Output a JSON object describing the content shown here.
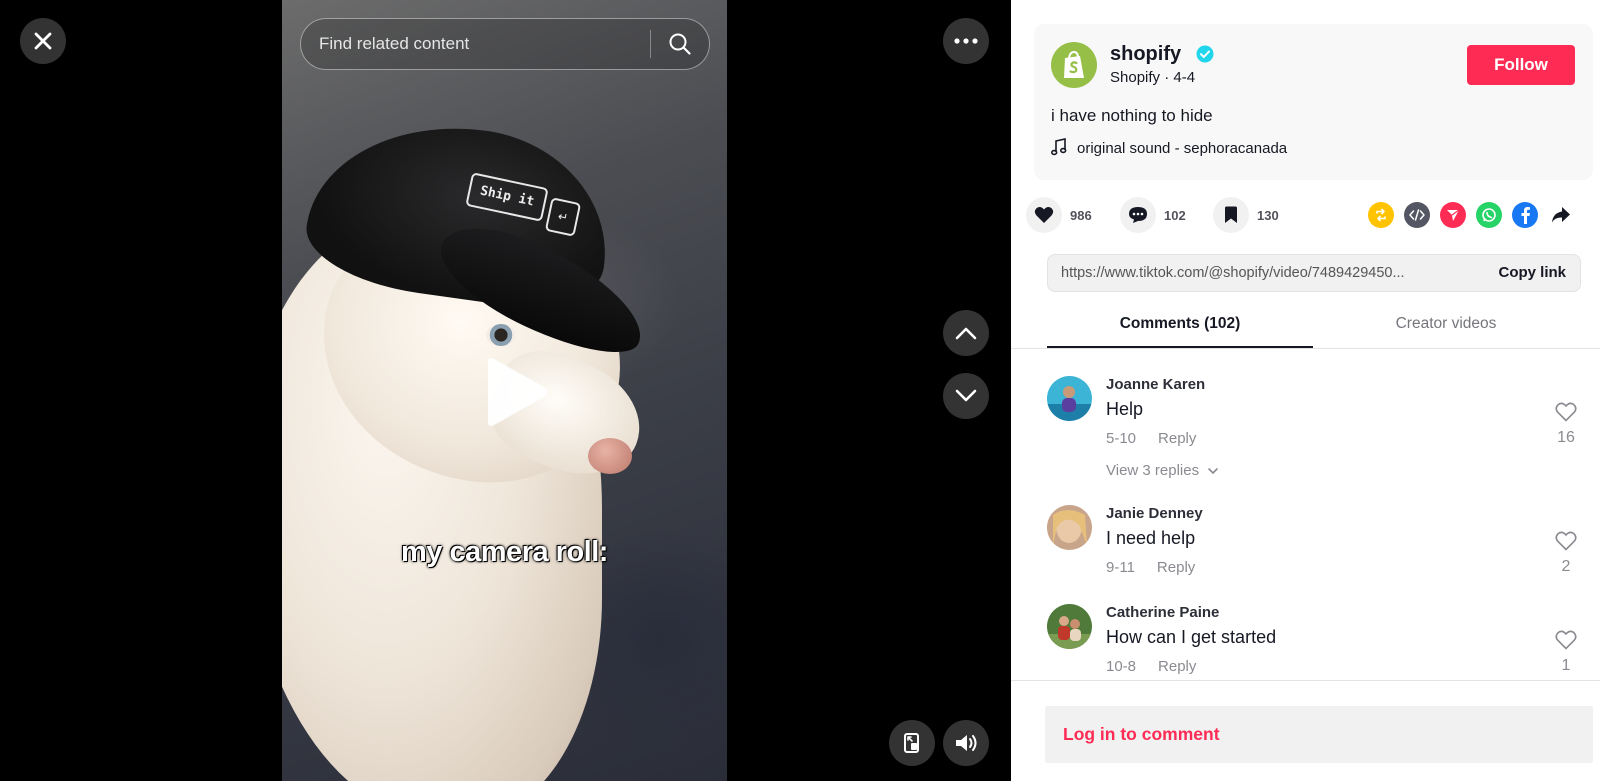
{
  "video": {
    "caption_overlay": "my camera roll:",
    "cap_text": "Ship it",
    "cap_key_symbol": "↵"
  },
  "search": {
    "placeholder": "Find related content"
  },
  "author": {
    "name": "shopify",
    "subtitle": "Shopify · 4-4",
    "follow_label": "Follow",
    "description": "i have nothing to hide",
    "sound": "original sound - sephoracanada"
  },
  "actions": {
    "likes": "986",
    "comments": "102",
    "saves": "130"
  },
  "share": {
    "icons": [
      "repost-icon",
      "embed-icon",
      "send-icon",
      "whatsapp-icon",
      "facebook-icon",
      "share-arrow-icon"
    ]
  },
  "link": {
    "url": "https://www.tiktok.com/@shopify/video/7489429450...",
    "copy_label": "Copy link"
  },
  "tabs": {
    "comments": "Comments (102)",
    "creator": "Creator videos"
  },
  "comments": [
    {
      "name": "Joanne Karen",
      "text": "Help",
      "date": "5-10",
      "reply": "Reply",
      "likes": "16",
      "view_replies": "View 3 replies"
    },
    {
      "name": "Janie Denney",
      "text": "I need help",
      "date": "9-11",
      "reply": "Reply",
      "likes": "2"
    },
    {
      "name": "Catherine Paine",
      "text": "How can I get started",
      "date": "10-8",
      "reply": "Reply",
      "likes": "1"
    }
  ],
  "footer": {
    "login_label": "Log in to comment"
  },
  "colors": {
    "accent": "#fe2c55",
    "shopify_green": "#95bf47",
    "verified_blue": "#20d5ec"
  }
}
